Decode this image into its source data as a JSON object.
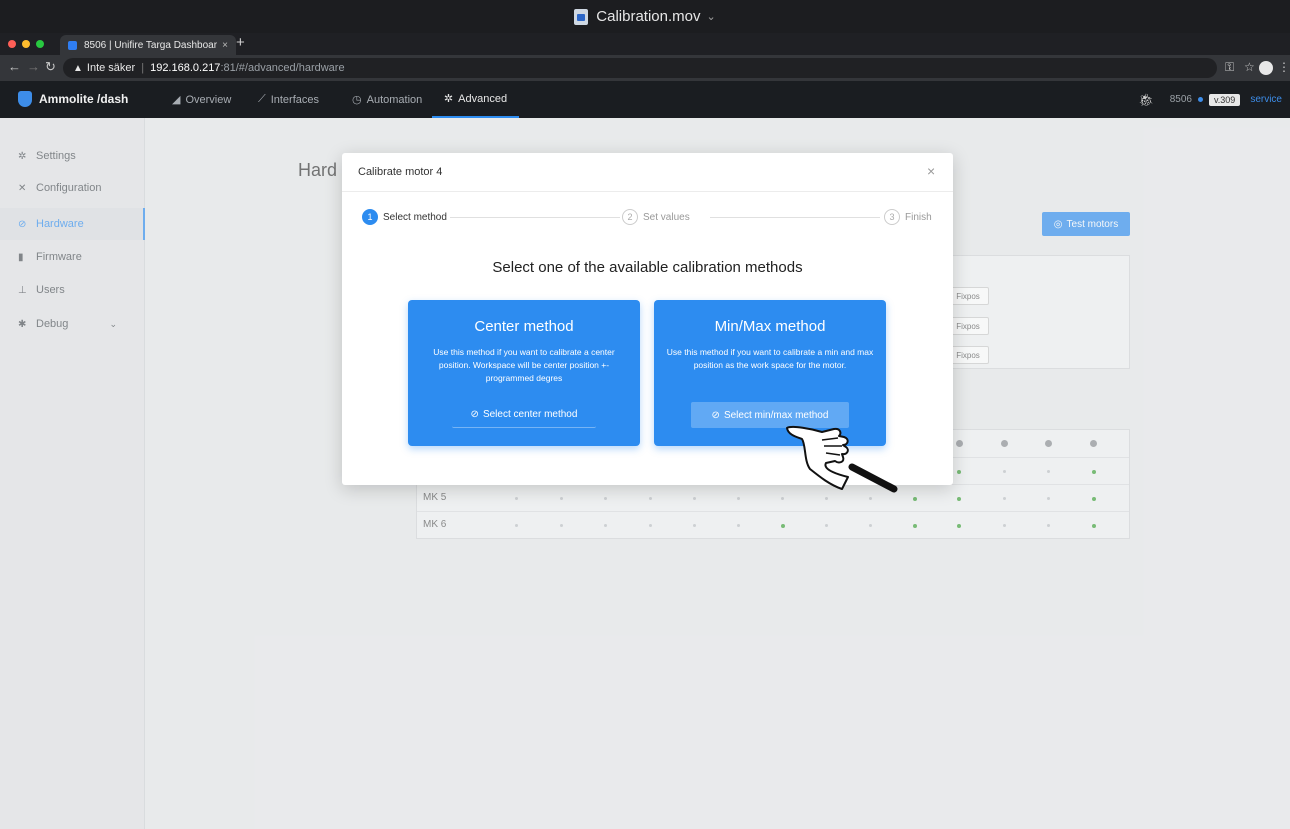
{
  "window": {
    "title": "Calibration.mov"
  },
  "browser": {
    "tab_title": "8506 | Unifire Targa Dashboar",
    "tab_close": "×",
    "new_tab": "+",
    "security": "Inte säker",
    "url_host": "192.168.0.217",
    "url_path": ":81/#/advanced/hardware"
  },
  "app": {
    "brand": "Ammolite /dash",
    "nav": [
      {
        "label": "Overview",
        "icon": "bar-chart-icon"
      },
      {
        "label": "Interfaces",
        "icon": "line-icon"
      },
      {
        "label": "Automation",
        "icon": "clock-icon"
      },
      {
        "label": "Advanced",
        "icon": "gear-icon"
      }
    ],
    "device": "8506",
    "version": "v.309",
    "role": "service"
  },
  "sidebar": {
    "items": [
      {
        "label": "Settings",
        "icon": "gear-icon"
      },
      {
        "label": "Configuration",
        "icon": "tools-icon"
      },
      {
        "label": "Hardware",
        "icon": "check-circle-icon"
      },
      {
        "label": "Firmware",
        "icon": "chip-icon"
      },
      {
        "label": "Users",
        "icon": "user-icon"
      },
      {
        "label": "Debug",
        "icon": "bug-icon"
      }
    ],
    "active": "Hardware"
  },
  "page": {
    "title": "Hard",
    "test_button": "Test motors",
    "fixpos": [
      "Fixpos",
      "Fixpos",
      "Fixpos"
    ],
    "grid_rows": [
      "MK 5",
      "MK 6"
    ]
  },
  "modal": {
    "title": "Calibrate motor 4",
    "close": "×",
    "steps": [
      {
        "num": "1",
        "label": "Select method"
      },
      {
        "num": "2",
        "label": "Set values"
      },
      {
        "num": "3",
        "label": "Finish"
      }
    ],
    "heading": "Select one of the available calibration methods",
    "center": {
      "title": "Center method",
      "desc": "Use this method if you want to calibrate a center position. Workspace will be center position +- programmed degres",
      "button": "Select center method"
    },
    "minmax": {
      "title": "Min/Max method",
      "desc": "Use this method if you want to calibrate a min and max position as the work space for the motor.",
      "button": "Select min/max method"
    }
  }
}
